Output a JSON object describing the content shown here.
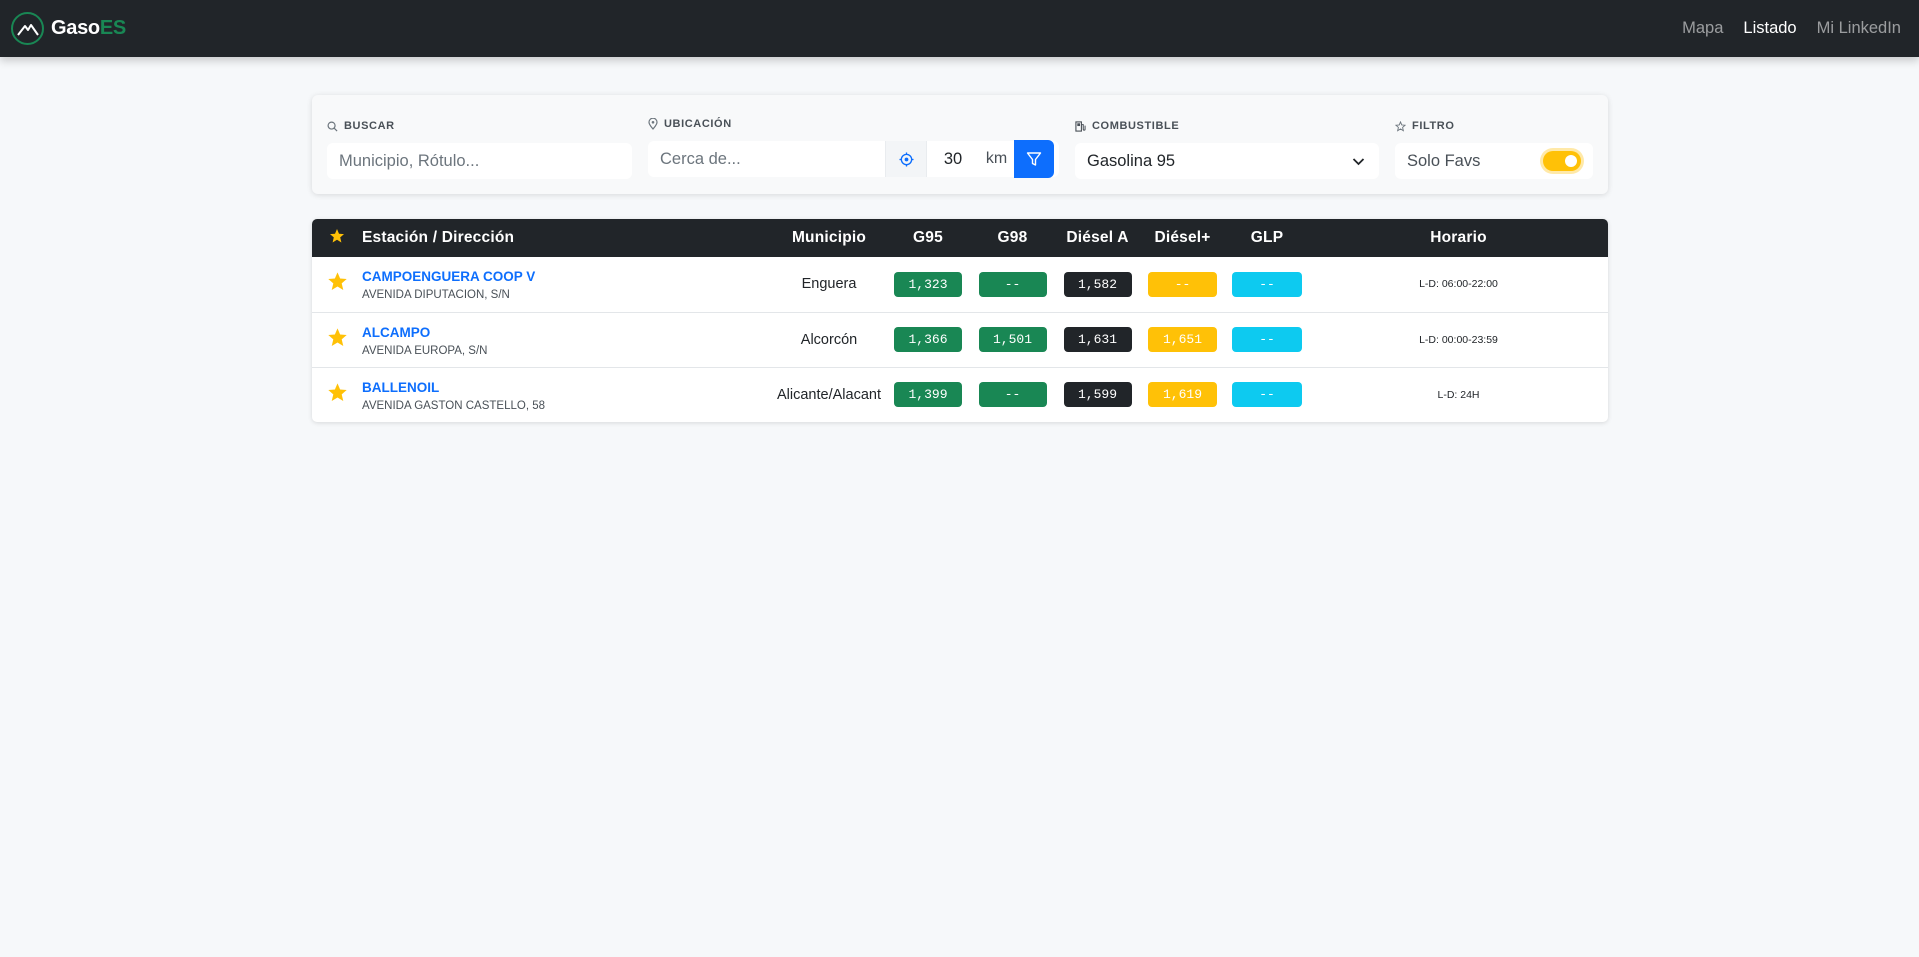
{
  "navbar": {
    "brand_main": "Gaso",
    "brand_accent": "ES",
    "links": [
      {
        "label": "Mapa",
        "active": false
      },
      {
        "label": "Listado",
        "active": true
      },
      {
        "label": "Mi LinkedIn",
        "active": false
      }
    ]
  },
  "filters": {
    "search": {
      "label": "BUSCAR",
      "placeholder": "Municipio, Rótulo...",
      "value": ""
    },
    "location": {
      "label": "UBICACIÓN",
      "placeholder": "Cerca de...",
      "radius": "30",
      "unit": "km"
    },
    "fuel": {
      "label": "COMBUSTIBLE",
      "selected": "Gasolina 95"
    },
    "favs": {
      "label": "FILTRO",
      "toggle_label": "Solo Favs",
      "enabled": true
    }
  },
  "table": {
    "headers": [
      "Estación / Dirección",
      "Municipio",
      "G95",
      "G98",
      "Diésel A",
      "Diésel+",
      "GLP",
      "Horario"
    ],
    "rows": [
      {
        "name": "CAMPOENGUERA COOP V",
        "address": "AVENIDA DIPUTACION, S/N",
        "municipio": "Enguera",
        "g95": "1,323",
        "g98": "--",
        "diesel_a": "1,582",
        "diesel_plus": "--",
        "glp": "--",
        "horario": "L-D: 06:00-22:00"
      },
      {
        "name": "ALCAMPO",
        "address": "AVENIDA EUROPA, S/N",
        "municipio": "Alcorcón",
        "g95": "1,366",
        "g98": "1,501",
        "diesel_a": "1,631",
        "diesel_plus": "1,651",
        "glp": "--",
        "horario": "L-D: 00:00-23:59"
      },
      {
        "name": "BALLENOIL",
        "address": "AVENIDA GASTON CASTELLO, 58",
        "municipio": "Alicante/Alacant",
        "g95": "1,399",
        "g98": "--",
        "diesel_a": "1,599",
        "diesel_plus": "1,619",
        "glp": "--",
        "horario": "L-D: 24H"
      }
    ]
  },
  "colors": {
    "brand_green": "#198754",
    "primary_blue": "#0d6efd",
    "star_yellow": "#ffc107",
    "glp_cyan": "#0dcaf0",
    "dark": "#212529"
  }
}
